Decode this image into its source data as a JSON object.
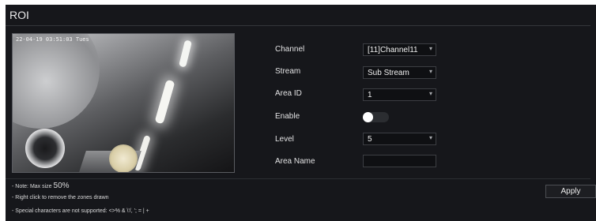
{
  "header": {
    "title": "ROI"
  },
  "video": {
    "osd_timestamp": "22-04-19 03:51:03 Tues"
  },
  "form": {
    "channel": {
      "label": "Channel",
      "value": "[11]Channel11"
    },
    "stream": {
      "label": "Stream",
      "value": "Sub Stream"
    },
    "area_id": {
      "label": "Area ID",
      "value": "1"
    },
    "enable": {
      "label": "Enable",
      "state": "off"
    },
    "level": {
      "label": "Level",
      "value": "5"
    },
    "area_name": {
      "label": "Area Name",
      "value": ""
    }
  },
  "notes": {
    "line1_prefix": "- Note: Max size",
    "line1_value": "50%",
    "line2": "- Right click to remove the zones drawn",
    "line3": "- Special characters are not supported: <>% & \\'/, '; = | +"
  },
  "actions": {
    "apply_label": "Apply"
  },
  "colors": {
    "background": "#16171b",
    "text": "#e3e3e4",
    "field": "#0f1013",
    "border": "#3c3e43"
  }
}
